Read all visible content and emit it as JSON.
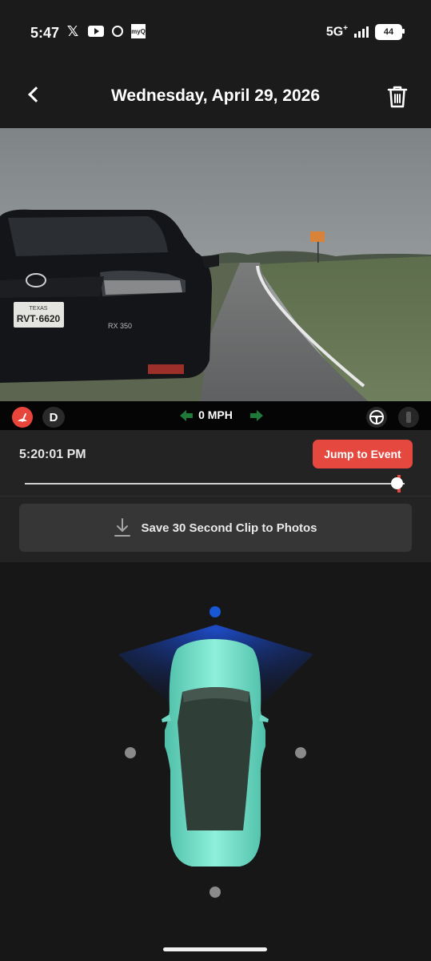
{
  "status_bar": {
    "time": "5:47",
    "network": "5G",
    "network_sup": "+",
    "battery": "44",
    "app_icons": [
      "x-icon",
      "youtube-icon",
      "camera-dot-icon",
      "myq-icon"
    ],
    "myq_label": "myQ"
  },
  "header": {
    "title": "Wednesday, April 29, 2026",
    "back_icon": "chevron-left-icon",
    "delete_icon": "trash-icon"
  },
  "hud": {
    "gear": "D",
    "speed": "0 MPH",
    "wiper_color": "#e4483f",
    "turn_arrow_color": "#2ea84f",
    "left_icons": [
      "wiper-icon"
    ],
    "right_icons": [
      "steering-wheel-icon",
      "pedal-icon"
    ]
  },
  "playback": {
    "timestamp": "5:20:01 PM",
    "jump_button": "Jump to Event",
    "scrub_position": 0.98,
    "accent": "#e4483f"
  },
  "save": {
    "label": "Save 30 Second Clip to Photos",
    "icon": "download-icon"
  },
  "vehicle": {
    "selected_camera": "front",
    "cameras": [
      "front",
      "left",
      "right",
      "rear"
    ],
    "active_color": "#1857d6",
    "inactive_color": "#8a8a8a",
    "car_color": "#6ed8c2"
  }
}
